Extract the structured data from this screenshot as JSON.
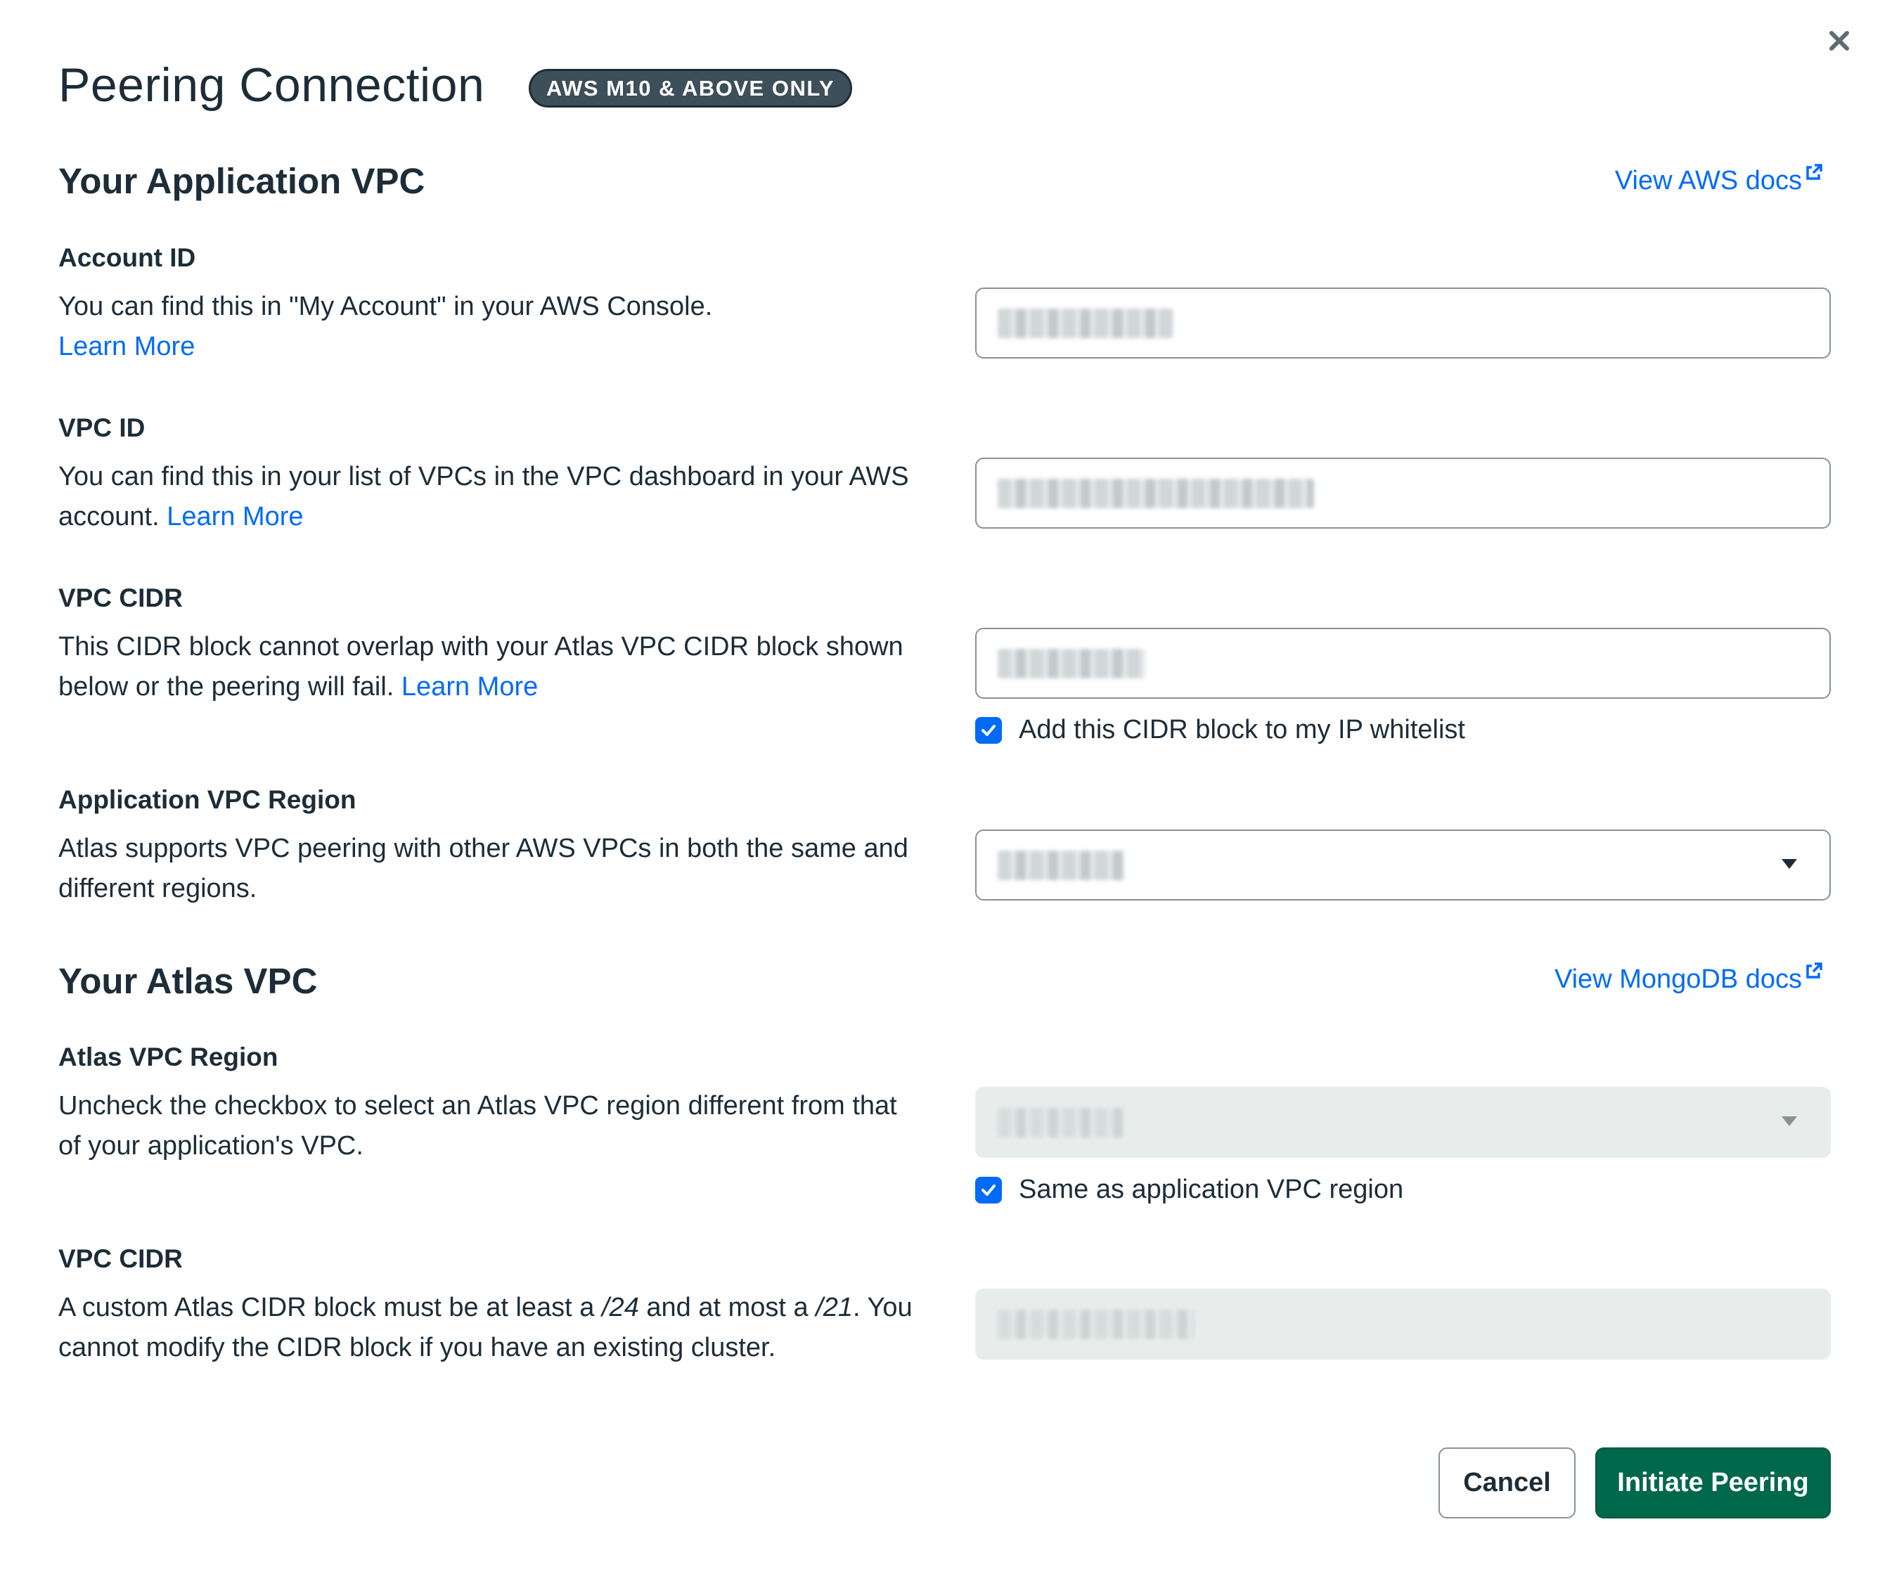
{
  "header": {
    "title": "Peering Connection",
    "badge": "AWS M10 & ABOVE ONLY",
    "close_icon": "close-icon"
  },
  "application_vpc": {
    "section_title": "Your Application VPC",
    "docs_link": "View AWS docs",
    "account_id": {
      "label": "Account ID",
      "desc": "You can find this in \"My Account\" in your AWS Console.",
      "link": "Learn More"
    },
    "vpc_id": {
      "label": "VPC ID",
      "desc": "You can find this in your list of VPCs in the VPC dashboard in your AWS account.",
      "link": "Learn More"
    },
    "vpc_cidr": {
      "label": "VPC CIDR",
      "desc": "This CIDR block cannot overlap with your Atlas VPC CIDR block shown below or the peering will fail.",
      "link": "Learn More",
      "checkbox_label": "Add this CIDR block to my IP whitelist",
      "checkbox_checked": true
    },
    "region": {
      "label": "Application VPC Region",
      "desc": "Atlas supports VPC peering with other AWS VPCs in both the same and different regions."
    }
  },
  "atlas_vpc": {
    "section_title": "Your Atlas VPC",
    "docs_link": "View MongoDB docs",
    "region": {
      "label": "Atlas VPC Region",
      "desc": "Uncheck the checkbox to select an Atlas VPC region different from that of your application's VPC.",
      "checkbox_label": "Same as application VPC region",
      "checkbox_checked": true
    },
    "vpc_cidr": {
      "label": "VPC CIDR",
      "desc_part1": "A custom Atlas CIDR block must be at least a ",
      "desc_em1": "/24",
      "desc_part2": " and at most a ",
      "desc_em2": "/21",
      "desc_part3": ". You cannot modify the CIDR block if you have an existing cluster."
    }
  },
  "footer": {
    "cancel_label": "Cancel",
    "submit_label": "Initiate Peering"
  },
  "colors": {
    "link": "#016bf8",
    "primary_button": "#00684a",
    "badge_bg": "#3d4f58",
    "text": "#1c2d38"
  }
}
